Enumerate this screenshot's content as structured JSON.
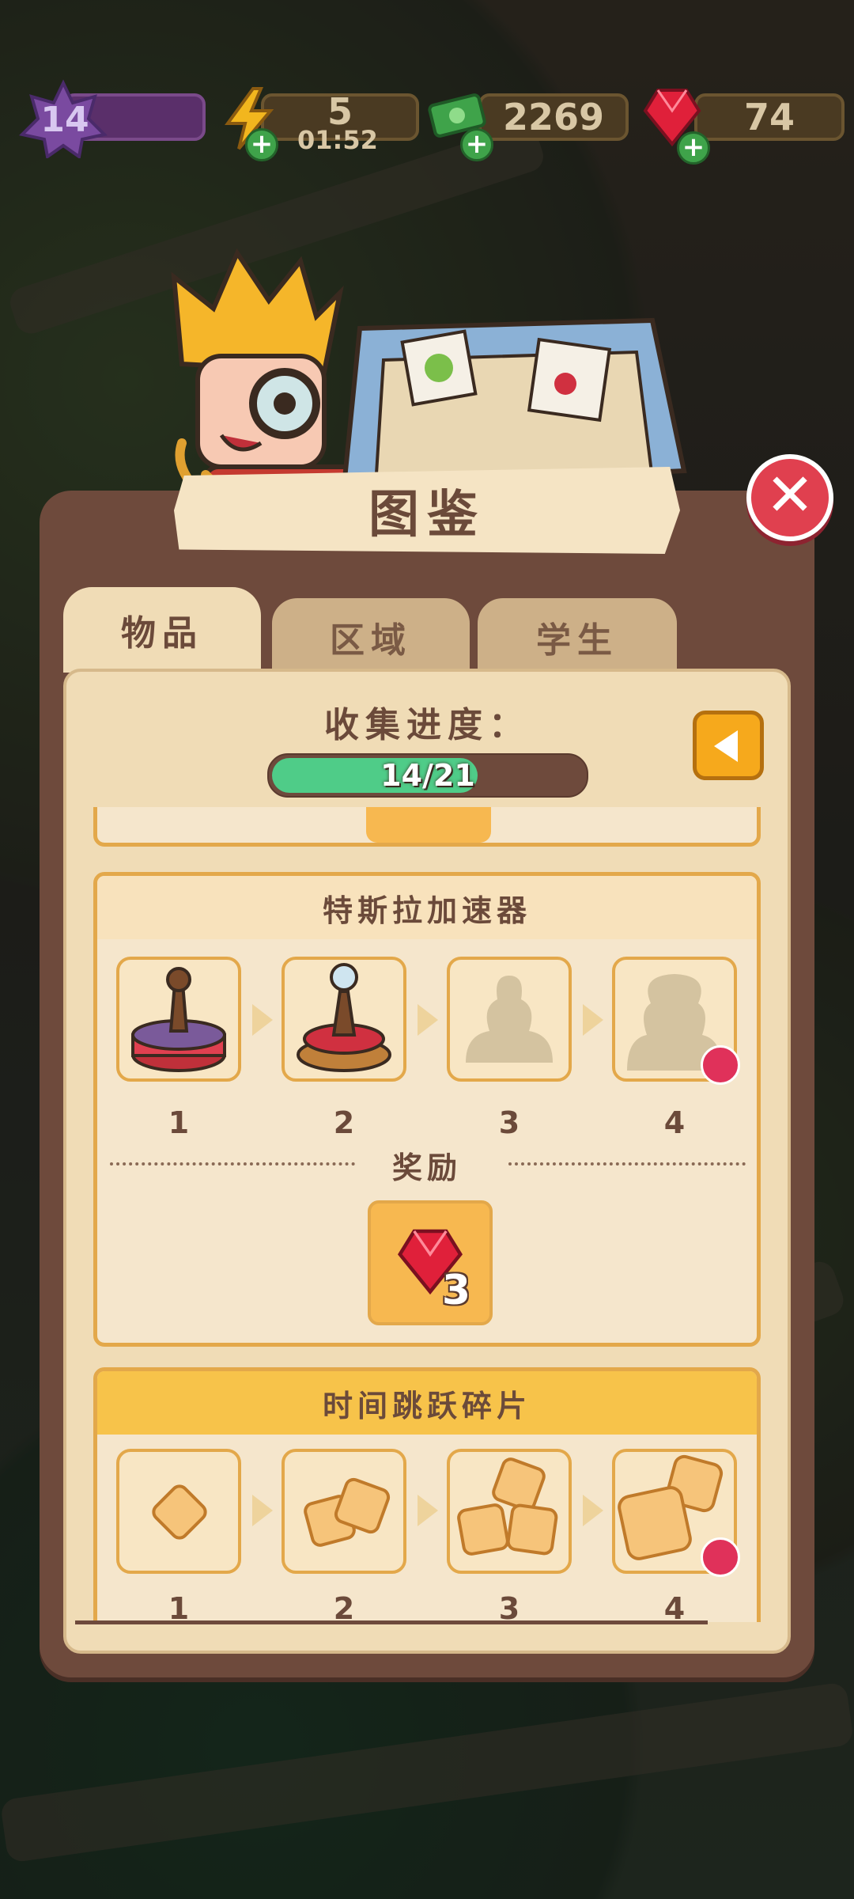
{
  "hud": {
    "level": "14",
    "energy": "5",
    "energy_timer": "01:52",
    "cash": "2269",
    "gems": "74"
  },
  "window": {
    "title": "图鉴",
    "tabs": [
      {
        "label": "物品",
        "active": true
      },
      {
        "label": "区域",
        "active": false
      },
      {
        "label": "学生",
        "active": false
      }
    ]
  },
  "progress": {
    "label": "收集进度：",
    "text": "14/21",
    "fraction": 0.667
  },
  "collections": [
    {
      "title": "特斯拉加速器",
      "items": [
        "1",
        "2",
        "3",
        "4"
      ],
      "unlocked": [
        true,
        true,
        false,
        false
      ],
      "reward_label": "奖励",
      "reward_count": "3"
    },
    {
      "title": "时间跳跃碎片",
      "items": [
        "1",
        "2",
        "3",
        "4"
      ],
      "unlocked": [
        true,
        true,
        true,
        true
      ]
    }
  ],
  "colors": {
    "panel": "#6e4a3c",
    "inner": "#f0dcb6",
    "progress_fill": "#4fcc88",
    "close": "#e0404f",
    "gem": "#e0203a",
    "accent": "#f6a91c"
  }
}
